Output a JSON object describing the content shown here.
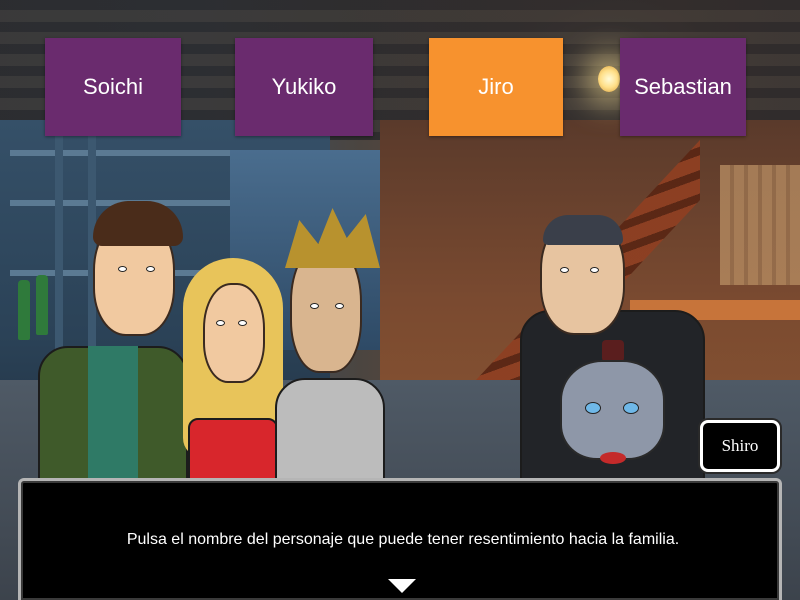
{
  "choices": [
    {
      "label": "Soichi",
      "color": "#6a2b6e",
      "selected": false
    },
    {
      "label": "Yukiko",
      "color": "#6a2b6e",
      "selected": false
    },
    {
      "label": "Jiro",
      "color": "#f7922e",
      "selected": true
    },
    {
      "label": "Sebastian",
      "color": "#6a2b6e",
      "selected": false
    }
  ],
  "speaker": {
    "name": "Shiro"
  },
  "dialog": {
    "text": "Pulsa el nombre del personaje que puede tener resentimiento hacia la familia.",
    "advance_icon": "triangle-down"
  },
  "colors": {
    "choice_default": "#6a2b6e",
    "choice_selected": "#f7922e",
    "dialog_bg": "#000000",
    "text": "#ffffff"
  }
}
